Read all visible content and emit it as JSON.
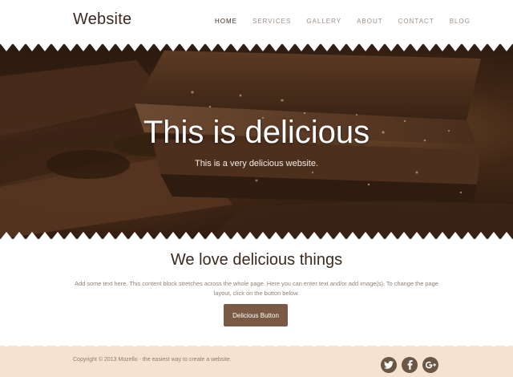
{
  "header": {
    "brand": "Website",
    "nav": [
      "HOME",
      "SERVICES",
      "GALLERY",
      "ABOUT",
      "CONTACT",
      "BLOG"
    ],
    "active_nav": "HOME"
  },
  "hero": {
    "title": "This is delicious",
    "subtitle": "This is a very delicious website."
  },
  "content": {
    "heading": "We love delicious things",
    "body": "Add some text here. This content block stretches across the whole page. Here you can enter text and/or add image(s). To change the page layout, click on the button below.",
    "button_label": "Delicious Button"
  },
  "footer": {
    "copyright": "Copyright © 2013 Mozello - the easiest way to create a website.",
    "social_icons": [
      "twitter-icon",
      "facebook-icon",
      "google-plus-icon"
    ]
  },
  "colors": {
    "accent_button": "#7a5a45",
    "footer_bg": "#f4e4cf",
    "social_icon_bg": "#6c5646",
    "hero_dark": "#2c1a10"
  }
}
